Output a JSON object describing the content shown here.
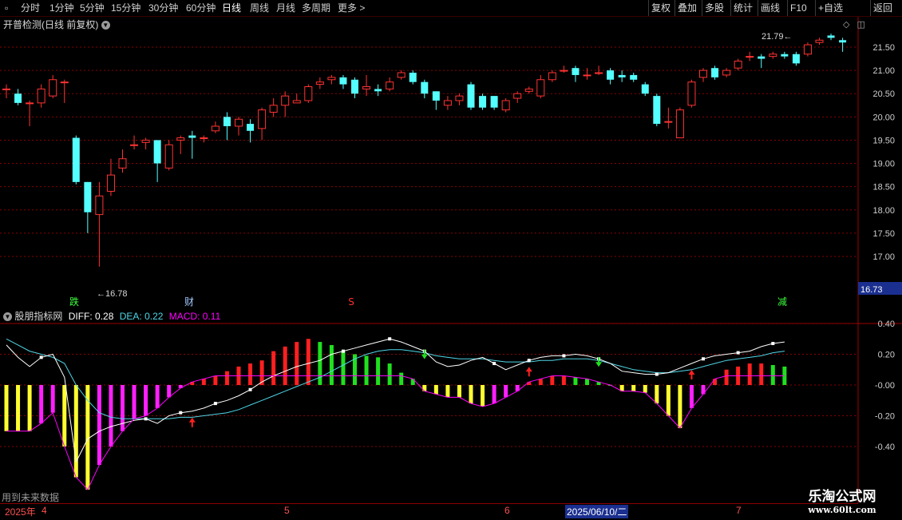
{
  "toolbar": {
    "periods": [
      "分时",
      "1分钟",
      "5分钟",
      "15分钟",
      "30分钟",
      "60分钟",
      "日线",
      "周线",
      "月线",
      "多周期",
      "更多"
    ],
    "active_period": "日线",
    "more_arrow": ">",
    "right_buttons": [
      "复权",
      "叠加",
      "多股",
      "统计",
      "画线",
      "F10",
      "+自选",
      "返回"
    ]
  },
  "price_panel": {
    "title": "开普检测(日线 前复权)",
    "axis_labels": [
      "21.50",
      "21.00",
      "20.50",
      "20.00",
      "19.50",
      "19.00",
      "18.50",
      "18.00",
      "17.50",
      "17.00"
    ],
    "current_price_tag": "16.73",
    "high_label": "21.79",
    "low_label": "16.78",
    "markers": [
      {
        "text": "跌",
        "color": "#3cff3c"
      },
      {
        "text": "财",
        "color": "#a0c8ff"
      },
      {
        "text": "S",
        "color": "#ff3030"
      },
      {
        "text": "减",
        "color": "#3cff3c"
      }
    ]
  },
  "indicator_panel": {
    "name": "股朋指标网",
    "diff_label": "DIFF: 0.28",
    "dea_label": "DEA: 0.22",
    "macd_label": "MACD: 0.11",
    "axis_labels": [
      "0.40",
      "0.20",
      "-0.00",
      "-0.20",
      "-0.40"
    ],
    "footnote": "用到未来数据"
  },
  "date_axis": {
    "labels": [
      "2025年",
      "4",
      "5",
      "6",
      "7"
    ],
    "cursor_date": "2025/06/10/二"
  },
  "watermark": {
    "line1": "乐淘公式网",
    "line2": "www.60lt.com"
  },
  "colors": {
    "up": "#ff3232",
    "down": "#54ffff",
    "grid": "#8b0000",
    "diff": "#ffffff",
    "dea": "#4fd6e6",
    "macd_line": "#ff00ff"
  },
  "chart_data": {
    "type": "candlestick",
    "ylim": [
      16.6,
      22.0
    ],
    "candles": [
      {
        "o": 20.6,
        "c": 20.6,
        "h": 20.7,
        "l": 20.4
      },
      {
        "o": 20.5,
        "c": 20.3,
        "h": 20.6,
        "l": 20.25
      },
      {
        "o": 20.3,
        "c": 20.3,
        "h": 20.35,
        "l": 19.8
      },
      {
        "o": 20.3,
        "c": 20.6,
        "h": 20.7,
        "l": 20.2
      },
      {
        "o": 20.45,
        "c": 20.8,
        "h": 20.9,
        "l": 20.4
      },
      {
        "o": 20.75,
        "c": 20.75,
        "h": 20.8,
        "l": 20.3
      },
      {
        "o": 19.55,
        "c": 18.6,
        "h": 19.6,
        "l": 18.55
      },
      {
        "o": 18.6,
        "c": 17.95,
        "h": 18.6,
        "l": 17.5
      },
      {
        "o": 17.9,
        "c": 18.3,
        "h": 18.6,
        "l": 16.78
      },
      {
        "o": 18.4,
        "c": 18.75,
        "h": 19.1,
        "l": 18.3
      },
      {
        "o": 18.9,
        "c": 19.1,
        "h": 19.3,
        "l": 18.8
      },
      {
        "o": 19.4,
        "c": 19.4,
        "h": 19.6,
        "l": 19.3
      },
      {
        "o": 19.45,
        "c": 19.5,
        "h": 19.55,
        "l": 19.3
      },
      {
        "o": 19.5,
        "c": 19.0,
        "h": 19.5,
        "l": 18.6
      },
      {
        "o": 18.9,
        "c": 19.4,
        "h": 19.5,
        "l": 18.85
      },
      {
        "o": 19.5,
        "c": 19.55,
        "h": 19.6,
        "l": 19.2
      },
      {
        "o": 19.6,
        "c": 19.55,
        "h": 19.7,
        "l": 19.1
      },
      {
        "o": 19.55,
        "c": 19.55,
        "h": 19.6,
        "l": 19.45
      },
      {
        "o": 19.7,
        "c": 19.8,
        "h": 19.9,
        "l": 19.65
      },
      {
        "o": 20.0,
        "c": 19.8,
        "h": 20.1,
        "l": 19.5
      },
      {
        "o": 19.8,
        "c": 19.95,
        "h": 20.0,
        "l": 19.6
      },
      {
        "o": 19.85,
        "c": 19.7,
        "h": 19.95,
        "l": 19.45
      },
      {
        "o": 19.75,
        "c": 20.15,
        "h": 20.2,
        "l": 19.5
      },
      {
        "o": 20.1,
        "c": 20.25,
        "h": 20.4,
        "l": 20.0
      },
      {
        "o": 20.25,
        "c": 20.45,
        "h": 20.55,
        "l": 20.0
      },
      {
        "o": 20.3,
        "c": 20.35,
        "h": 20.5,
        "l": 20.3
      },
      {
        "o": 20.35,
        "c": 20.65,
        "h": 20.7,
        "l": 20.3
      },
      {
        "o": 20.7,
        "c": 20.75,
        "h": 20.85,
        "l": 20.6
      },
      {
        "o": 20.8,
        "c": 20.85,
        "h": 20.9,
        "l": 20.7
      },
      {
        "o": 20.85,
        "c": 20.7,
        "h": 20.9,
        "l": 20.6
      },
      {
        "o": 20.8,
        "c": 20.5,
        "h": 20.85,
        "l": 20.4
      },
      {
        "o": 20.6,
        "c": 20.65,
        "h": 20.9,
        "l": 20.45
      },
      {
        "o": 20.6,
        "c": 20.55,
        "h": 20.7,
        "l": 20.45
      },
      {
        "o": 20.6,
        "c": 20.75,
        "h": 20.85,
        "l": 20.55
      },
      {
        "o": 20.85,
        "c": 20.95,
        "h": 21.0,
        "l": 20.8
      },
      {
        "o": 20.95,
        "c": 20.75,
        "h": 21.0,
        "l": 20.7
      },
      {
        "o": 20.75,
        "c": 20.5,
        "h": 20.8,
        "l": 20.4
      },
      {
        "o": 20.55,
        "c": 20.35,
        "h": 20.55,
        "l": 20.15
      },
      {
        "o": 20.25,
        "c": 20.35,
        "h": 20.45,
        "l": 20.15
      },
      {
        "o": 20.35,
        "c": 20.45,
        "h": 20.5,
        "l": 20.25
      },
      {
        "o": 20.7,
        "c": 20.2,
        "h": 20.75,
        "l": 20.15
      },
      {
        "o": 20.45,
        "c": 20.2,
        "h": 20.5,
        "l": 20.15
      },
      {
        "o": 20.45,
        "c": 20.2,
        "h": 20.45,
        "l": 20.15
      },
      {
        "o": 20.15,
        "c": 20.35,
        "h": 20.4,
        "l": 20.1
      },
      {
        "o": 20.4,
        "c": 20.5,
        "h": 20.55,
        "l": 20.3
      },
      {
        "o": 20.55,
        "c": 20.6,
        "h": 20.65,
        "l": 20.5
      },
      {
        "o": 20.45,
        "c": 20.8,
        "h": 20.9,
        "l": 20.4
      },
      {
        "o": 20.8,
        "c": 20.95,
        "h": 21.0,
        "l": 20.75
      },
      {
        "o": 21.0,
        "c": 21.0,
        "h": 21.1,
        "l": 20.95
      },
      {
        "o": 21.05,
        "c": 20.9,
        "h": 21.1,
        "l": 20.75
      },
      {
        "o": 20.9,
        "c": 20.9,
        "h": 21.05,
        "l": 20.8
      },
      {
        "o": 20.95,
        "c": 20.95,
        "h": 21.1,
        "l": 20.9
      },
      {
        "o": 21.0,
        "c": 20.8,
        "h": 21.05,
        "l": 20.7
      },
      {
        "o": 20.9,
        "c": 20.85,
        "h": 21.0,
        "l": 20.75
      },
      {
        "o": 20.9,
        "c": 20.8,
        "h": 20.95,
        "l": 20.75
      },
      {
        "o": 20.7,
        "c": 20.5,
        "h": 20.75,
        "l": 20.45
      },
      {
        "o": 20.45,
        "c": 19.85,
        "h": 20.5,
        "l": 19.8
      },
      {
        "o": 19.9,
        "c": 19.9,
        "h": 20.2,
        "l": 19.75
      },
      {
        "o": 19.55,
        "c": 20.15,
        "h": 20.2,
        "l": 19.55
      },
      {
        "o": 20.25,
        "c": 20.75,
        "h": 20.8,
        "l": 20.2
      },
      {
        "o": 20.85,
        "c": 21.0,
        "h": 21.05,
        "l": 20.75
      },
      {
        "o": 21.05,
        "c": 20.85,
        "h": 21.1,
        "l": 20.8
      },
      {
        "o": 20.9,
        "c": 21.0,
        "h": 21.05,
        "l": 20.85
      },
      {
        "o": 21.05,
        "c": 21.2,
        "h": 21.25,
        "l": 21.0
      },
      {
        "o": 21.3,
        "c": 21.3,
        "h": 21.4,
        "l": 21.2
      },
      {
        "o": 21.3,
        "c": 21.25,
        "h": 21.35,
        "l": 21.05
      },
      {
        "o": 21.3,
        "c": 21.35,
        "h": 21.4,
        "l": 21.25
      },
      {
        "o": 21.35,
        "c": 21.3,
        "h": 21.4,
        "l": 21.25
      },
      {
        "o": 21.35,
        "c": 21.15,
        "h": 21.4,
        "l": 21.1
      },
      {
        "o": 21.35,
        "c": 21.55,
        "h": 21.6,
        "l": 21.3
      },
      {
        "o": 21.6,
        "c": 21.65,
        "h": 21.7,
        "l": 21.55
      },
      {
        "o": 21.75,
        "c": 21.7,
        "h": 21.79,
        "l": 21.65
      },
      {
        "o": 21.65,
        "c": 21.6,
        "h": 21.7,
        "l": 21.4
      }
    ],
    "macd": {
      "ylim": [
        -0.72,
        0.5
      ],
      "diff": [
        0.26,
        0.18,
        0.12,
        0.18,
        0.2,
        0.05,
        -0.5,
        -0.35,
        -0.3,
        -0.27,
        -0.25,
        -0.23,
        -0.22,
        -0.25,
        -0.2,
        -0.18,
        -0.17,
        -0.15,
        -0.12,
        -0.1,
        -0.07,
        -0.03,
        0.02,
        0.06,
        0.09,
        0.12,
        0.14,
        0.16,
        0.2,
        0.22,
        0.24,
        0.26,
        0.28,
        0.3,
        0.28,
        0.25,
        0.22,
        0.15,
        0.12,
        0.13,
        0.16,
        0.18,
        0.14,
        0.1,
        0.13,
        0.16,
        0.18,
        0.19,
        0.19,
        0.2,
        0.19,
        0.17,
        0.14,
        0.09,
        0.08,
        0.07,
        0.07,
        0.08,
        0.11,
        0.14,
        0.17,
        0.19,
        0.2,
        0.21,
        0.22,
        0.25,
        0.27,
        0.28
      ],
      "dea": [
        0.3,
        0.26,
        0.22,
        0.2,
        0.18,
        0.14,
        0.0,
        -0.1,
        -0.18,
        -0.21,
        -0.22,
        -0.22,
        -0.22,
        -0.22,
        -0.22,
        -0.21,
        -0.21,
        -0.2,
        -0.19,
        -0.18,
        -0.16,
        -0.13,
        -0.1,
        -0.07,
        -0.04,
        -0.01,
        0.02,
        0.05,
        0.09,
        0.13,
        0.17,
        0.2,
        0.22,
        0.23,
        0.23,
        0.22,
        0.21,
        0.19,
        0.18,
        0.17,
        0.17,
        0.17,
        0.16,
        0.15,
        0.15,
        0.15,
        0.16,
        0.16,
        0.17,
        0.17,
        0.17,
        0.16,
        0.14,
        0.12,
        0.1,
        0.09,
        0.08,
        0.08,
        0.09,
        0.1,
        0.12,
        0.14,
        0.16,
        0.17,
        0.18,
        0.19,
        0.21,
        0.22
      ],
      "macd": [
        -0.3,
        -0.3,
        -0.3,
        -0.25,
        -0.18,
        -0.4,
        -0.6,
        -0.68,
        -0.52,
        -0.4,
        -0.3,
        -0.22,
        -0.2,
        -0.15,
        -0.08,
        -0.02,
        0.02,
        0.04,
        0.06,
        0.09,
        0.12,
        0.14,
        0.16,
        0.22,
        0.25,
        0.28,
        0.3,
        0.28,
        0.26,
        0.22,
        0.2,
        0.19,
        0.18,
        0.14,
        0.08,
        0.04,
        -0.04,
        -0.06,
        -0.08,
        -0.08,
        -0.12,
        -0.14,
        -0.12,
        -0.08,
        -0.04,
        0.02,
        0.04,
        0.06,
        0.06,
        0.05,
        0.04,
        0.02,
        0.0,
        -0.04,
        -0.04,
        -0.05,
        -0.12,
        -0.2,
        -0.28,
        -0.15,
        -0.06,
        0.04,
        0.1,
        0.12,
        0.14,
        0.14,
        0.13,
        0.12
      ]
    }
  }
}
